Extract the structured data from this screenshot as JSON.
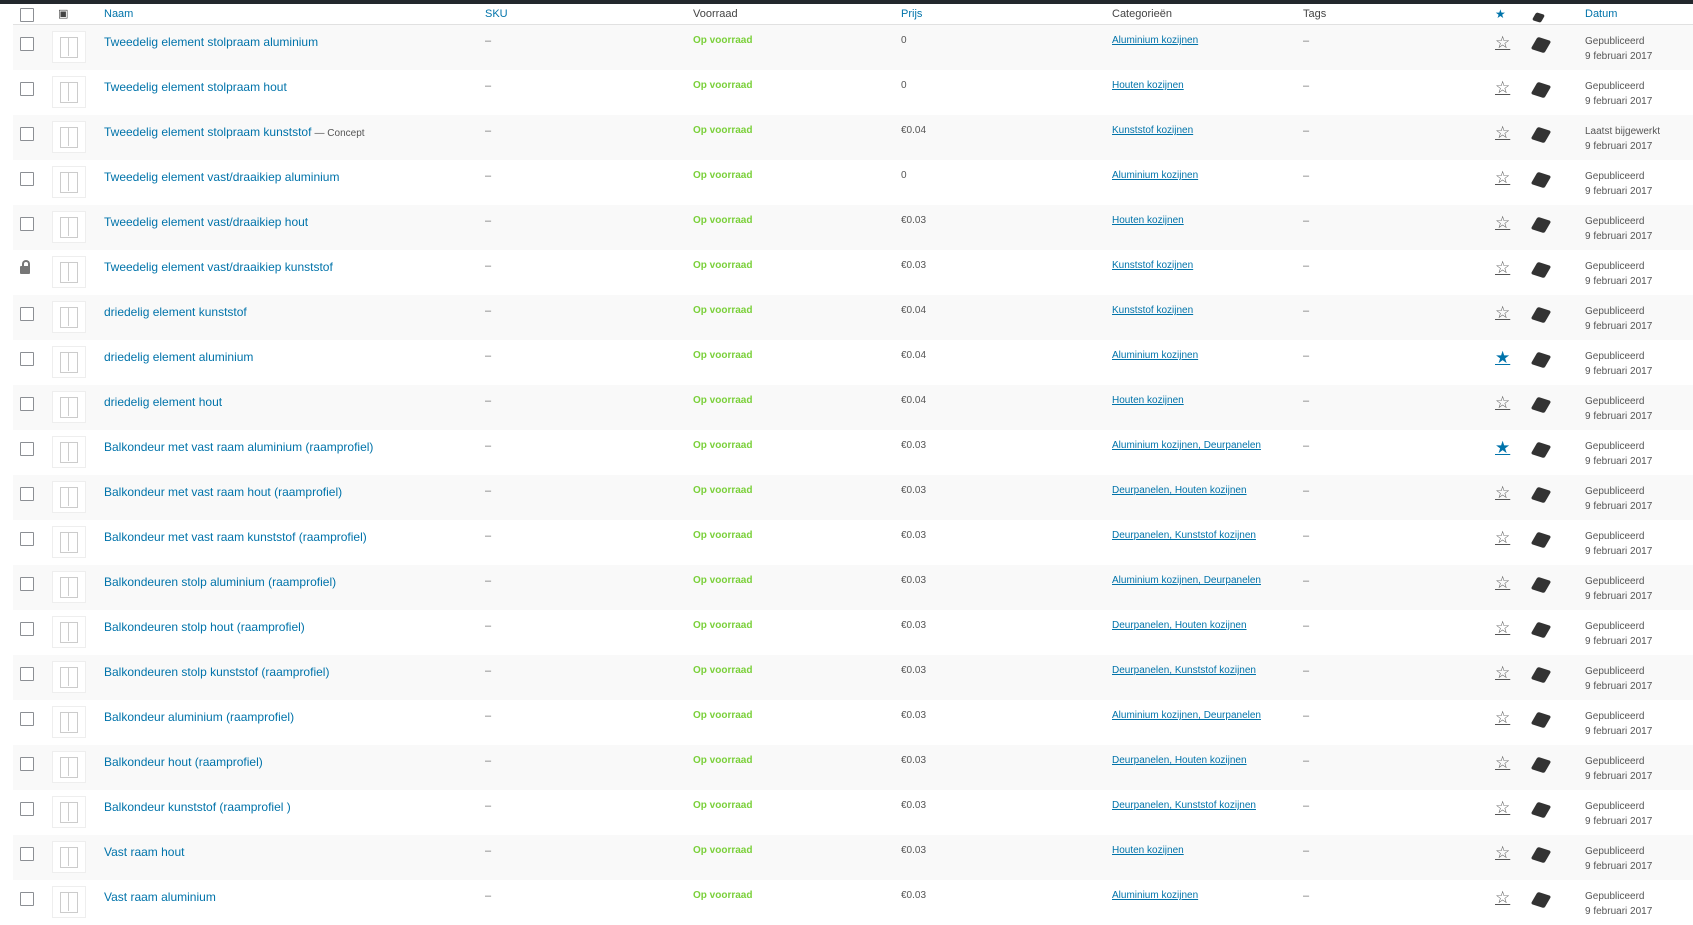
{
  "header": {
    "name": "Naam",
    "sku": "SKU",
    "stock": "Voorraad",
    "price": "Prijs",
    "categories": "Categorieën",
    "tags": "Tags",
    "date": "Datum",
    "featured_icon": "star-icon",
    "type_icon": "product-type-icon",
    "image_icon": "image-icon"
  },
  "rows": [
    {
      "name": "Tweedelig element stolpraam aluminium",
      "state": "",
      "sku": "–",
      "stock": "Op voorraad",
      "price": "0",
      "categories": "Aluminium kozijnen",
      "tags": "–",
      "featured": false,
      "locked": false,
      "status": "Gepubliceerd",
      "date": "9 februari 2017"
    },
    {
      "name": "Tweedelig element stolpraam hout",
      "state": "",
      "sku": "–",
      "stock": "Op voorraad",
      "price": "0",
      "categories": "Houten kozijnen",
      "tags": "–",
      "featured": false,
      "locked": false,
      "status": "Gepubliceerd",
      "date": "9 februari 2017"
    },
    {
      "name": "Tweedelig element stolpraam kunststof",
      "state": "— Concept",
      "sku": "–",
      "stock": "Op voorraad",
      "price": "€0.04",
      "categories": "Kunststof kozijnen",
      "tags": "–",
      "featured": false,
      "locked": false,
      "status": "Laatst bijgewerkt",
      "date": "9 februari 2017"
    },
    {
      "name": "Tweedelig element vast/draaikiep aluminium",
      "state": "",
      "sku": "–",
      "stock": "Op voorraad",
      "price": "0",
      "categories": "Aluminium kozijnen",
      "tags": "–",
      "featured": false,
      "locked": false,
      "status": "Gepubliceerd",
      "date": "9 februari 2017"
    },
    {
      "name": "Tweedelig element vast/draaikiep hout",
      "state": "",
      "sku": "–",
      "stock": "Op voorraad",
      "price": "€0.03",
      "categories": "Houten kozijnen",
      "tags": "–",
      "featured": false,
      "locked": false,
      "status": "Gepubliceerd",
      "date": "9 februari 2017"
    },
    {
      "name": "Tweedelig element vast/draaikiep kunststof",
      "state": "",
      "sku": "–",
      "stock": "Op voorraad",
      "price": "€0.03",
      "categories": "Kunststof kozijnen",
      "tags": "–",
      "featured": false,
      "locked": true,
      "status": "Gepubliceerd",
      "date": "9 februari 2017"
    },
    {
      "name": "driedelig element kunststof",
      "state": "",
      "sku": "–",
      "stock": "Op voorraad",
      "price": "€0.04",
      "categories": "Kunststof kozijnen",
      "tags": "–",
      "featured": false,
      "locked": false,
      "status": "Gepubliceerd",
      "date": "9 februari 2017"
    },
    {
      "name": "driedelig element aluminium",
      "state": "",
      "sku": "–",
      "stock": "Op voorraad",
      "price": "€0.04",
      "categories": "Aluminium kozijnen",
      "tags": "–",
      "featured": true,
      "locked": false,
      "status": "Gepubliceerd",
      "date": "9 februari 2017"
    },
    {
      "name": "driedelig element hout",
      "state": "",
      "sku": "–",
      "stock": "Op voorraad",
      "price": "€0.04",
      "categories": "Houten kozijnen",
      "tags": "–",
      "featured": false,
      "locked": false,
      "status": "Gepubliceerd",
      "date": "9 februari 2017"
    },
    {
      "name": "Balkondeur met vast raam aluminium (raamprofiel)",
      "state": "",
      "sku": "–",
      "stock": "Op voorraad",
      "price": "€0.03",
      "categories": "Aluminium kozijnen, Deurpanelen",
      "tags": "–",
      "featured": true,
      "locked": false,
      "status": "Gepubliceerd",
      "date": "9 februari 2017"
    },
    {
      "name": "Balkondeur met vast raam hout (raamprofiel)",
      "state": "",
      "sku": "–",
      "stock": "Op voorraad",
      "price": "€0.03",
      "categories": "Deurpanelen, Houten kozijnen",
      "tags": "–",
      "featured": false,
      "locked": false,
      "status": "Gepubliceerd",
      "date": "9 februari 2017"
    },
    {
      "name": "Balkondeur met vast raam kunststof (raamprofiel)",
      "state": "",
      "sku": "–",
      "stock": "Op voorraad",
      "price": "€0.03",
      "categories": "Deurpanelen, Kunststof kozijnen",
      "tags": "–",
      "featured": false,
      "locked": false,
      "status": "Gepubliceerd",
      "date": "9 februari 2017"
    },
    {
      "name": "Balkondeuren stolp aluminium (raamprofiel)",
      "state": "",
      "sku": "–",
      "stock": "Op voorraad",
      "price": "€0.03",
      "categories": "Aluminium kozijnen, Deurpanelen",
      "tags": "–",
      "featured": false,
      "locked": false,
      "status": "Gepubliceerd",
      "date": "9 februari 2017"
    },
    {
      "name": "Balkondeuren stolp hout (raamprofiel)",
      "state": "",
      "sku": "–",
      "stock": "Op voorraad",
      "price": "€0.03",
      "categories": "Deurpanelen, Houten kozijnen",
      "tags": "–",
      "featured": false,
      "locked": false,
      "status": "Gepubliceerd",
      "date": "9 februari 2017"
    },
    {
      "name": "Balkondeuren stolp kunststof (raamprofiel)",
      "state": "",
      "sku": "–",
      "stock": "Op voorraad",
      "price": "€0.03",
      "categories": "Deurpanelen, Kunststof kozijnen",
      "tags": "–",
      "featured": false,
      "locked": false,
      "status": "Gepubliceerd",
      "date": "9 februari 2017"
    },
    {
      "name": "Balkondeur aluminium (raamprofiel)",
      "state": "",
      "sku": "–",
      "stock": "Op voorraad",
      "price": "€0.03",
      "categories": "Aluminium kozijnen, Deurpanelen",
      "tags": "–",
      "featured": false,
      "locked": false,
      "status": "Gepubliceerd",
      "date": "9 februari 2017"
    },
    {
      "name": "Balkondeur hout (raamprofiel)",
      "state": "",
      "sku": "–",
      "stock": "Op voorraad",
      "price": "€0.03",
      "categories": "Deurpanelen, Houten kozijnen",
      "tags": "–",
      "featured": false,
      "locked": false,
      "status": "Gepubliceerd",
      "date": "9 februari 2017"
    },
    {
      "name": "Balkondeur kunststof (raamprofiel )",
      "state": "",
      "sku": "–",
      "stock": "Op voorraad",
      "price": "€0.03",
      "categories": "Deurpanelen, Kunststof kozijnen",
      "tags": "–",
      "featured": false,
      "locked": false,
      "status": "Gepubliceerd",
      "date": "9 februari 2017"
    },
    {
      "name": "Vast raam hout",
      "state": "",
      "sku": "–",
      "stock": "Op voorraad",
      "price": "€0.03",
      "categories": "Houten kozijnen",
      "tags": "–",
      "featured": false,
      "locked": false,
      "status": "Gepubliceerd",
      "date": "9 februari 2017"
    },
    {
      "name": "Vast raam aluminium",
      "state": "",
      "sku": "–",
      "stock": "Op voorraad",
      "price": "€0.03",
      "categories": "Aluminium kozijnen",
      "tags": "–",
      "featured": false,
      "locked": false,
      "status": "Gepubliceerd",
      "date": "9 februari 2017"
    }
  ]
}
